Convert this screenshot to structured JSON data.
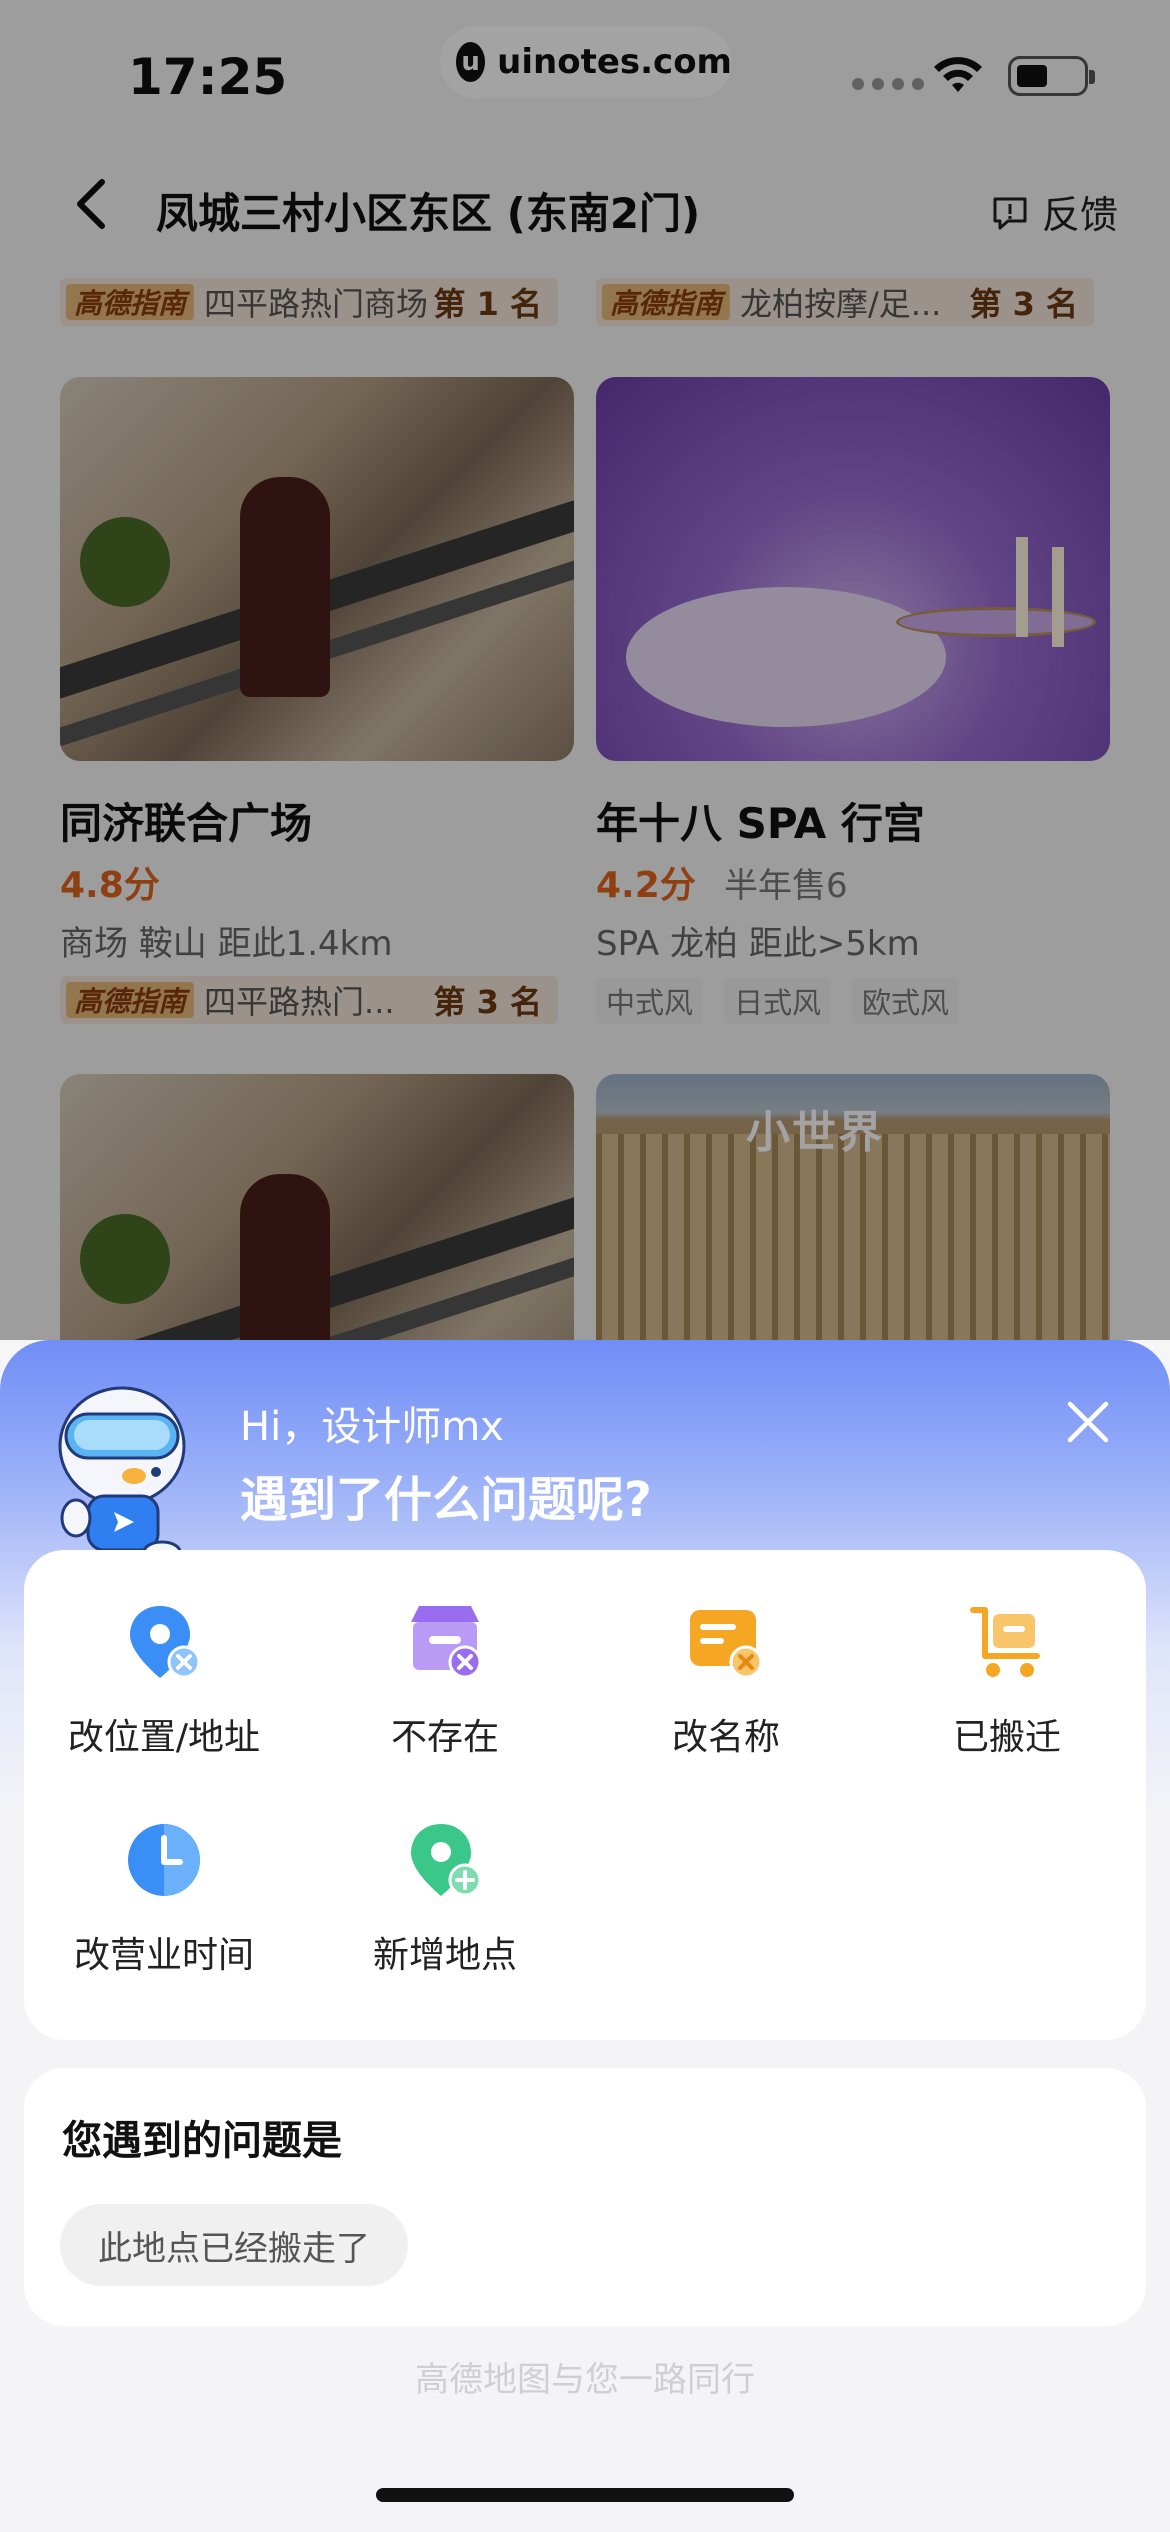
{
  "status": {
    "time": "17:25",
    "url": "uinotes.com"
  },
  "nav": {
    "title": "凤城三村小区东区 (东南2门)",
    "feedback": "反馈"
  },
  "top_ranks": [
    {
      "brand": "高德指南",
      "location": "四平路热门商场",
      "position": "第 1 名"
    },
    {
      "brand": "高德指南",
      "location": "龙柏按摩/足...",
      "position": "第 3 名"
    }
  ],
  "cards": [
    {
      "name": "同济联合广场",
      "rating": "4.8分",
      "meta": "商场  鞍山  距此1.4km",
      "rank_brand": "高德指南",
      "rank_location": "四平路热门...",
      "rank_position": "第 3 名"
    },
    {
      "name": "年十八 SPA 行宫",
      "rating": "4.2分",
      "sold": "半年售6",
      "meta": "SPA  龙柏  距此>5km",
      "tags": [
        "中式风",
        "日式风",
        "欧式风"
      ]
    },
    {
      "sign": "小世界"
    }
  ],
  "sheet": {
    "greeting": "Hi，设计师mx",
    "question": "遇到了什么问题呢?",
    "options": [
      {
        "label": "改位置/地址",
        "icon": "location-error-icon",
        "color": "#3a8ef6"
      },
      {
        "label": "不存在",
        "icon": "store-closed-icon",
        "color": "#9a6cf0"
      },
      {
        "label": "改名称",
        "icon": "rename-icon",
        "color": "#f5a623"
      },
      {
        "label": "已搬迁",
        "icon": "moved-cart-icon",
        "color": "#f5a623"
      },
      {
        "label": "改营业时间",
        "icon": "clock-icon",
        "color": "#3a8ef6"
      },
      {
        "label": "新增地点",
        "icon": "add-location-icon",
        "color": "#3cc78a"
      }
    ],
    "problem_title": "您遇到的问题是",
    "selected_problem": "此地点已经搬走了",
    "footer": "高德地图与您一路同行"
  }
}
